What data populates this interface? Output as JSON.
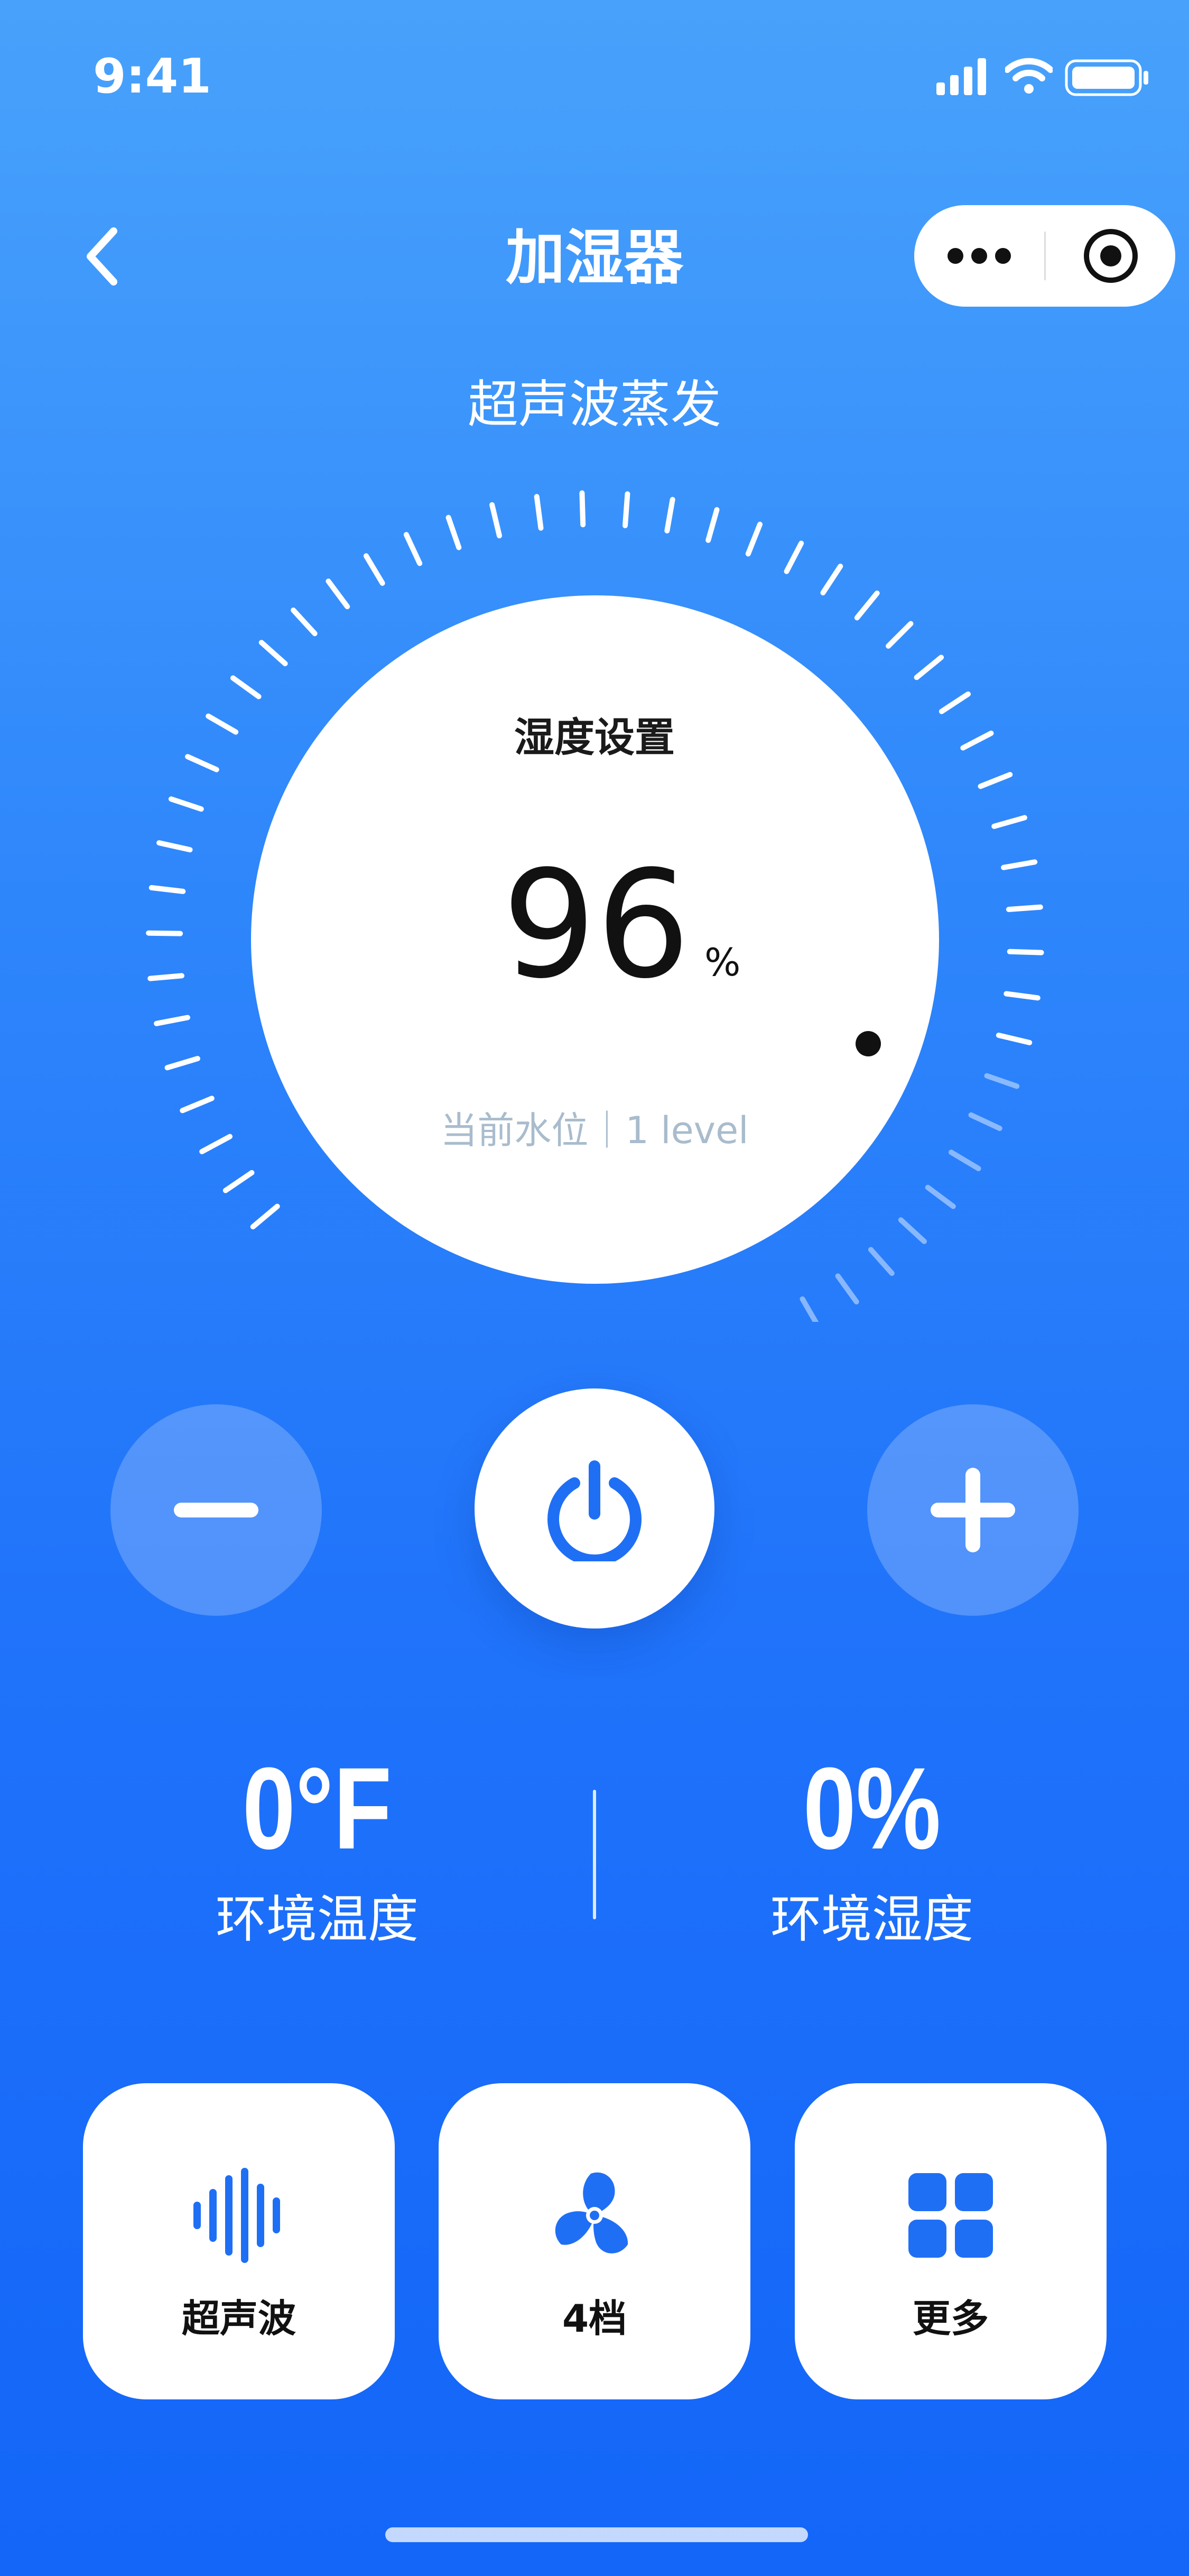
{
  "status_bar": {
    "time": "9:41"
  },
  "header": {
    "title": "加湿器"
  },
  "mode": {
    "label": "超声波蒸发"
  },
  "dial": {
    "label": "湿度设置",
    "value": "96",
    "unit": "%",
    "water_level": "当前水位｜1 level",
    "setting_fraction": 0.96
  },
  "controls": {
    "minus": "minus-icon",
    "power": "power-icon",
    "plus": "plus-icon"
  },
  "environment": {
    "temperature": {
      "value": "0°F",
      "label": "环境温度"
    },
    "humidity": {
      "value": "0%",
      "label": "环境湿度"
    }
  },
  "cards": [
    {
      "label": "超声波",
      "icon": "sound-wave-icon"
    },
    {
      "label": "4档",
      "icon": "fan-icon"
    },
    {
      "label": "更多",
      "icon": "grid-icon"
    }
  ],
  "colors": {
    "accent": "#1f6ff5",
    "background_top": "#48a2fb",
    "background_bottom": "#1366f8"
  }
}
